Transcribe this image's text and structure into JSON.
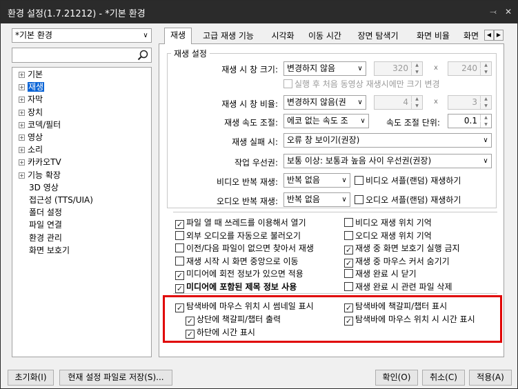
{
  "window": {
    "title": "환경 설정(1.7.21212) - *기본 환경"
  },
  "left": {
    "profile": "*기본 환경",
    "search_placeholder": "",
    "tree": [
      {
        "label": "기본",
        "expandable": true,
        "selected": false
      },
      {
        "label": "재생",
        "expandable": true,
        "selected": true
      },
      {
        "label": "자막",
        "expandable": true,
        "selected": false
      },
      {
        "label": "장치",
        "expandable": true,
        "selected": false
      },
      {
        "label": "코덱/필터",
        "expandable": true,
        "selected": false
      },
      {
        "label": "영상",
        "expandable": true,
        "selected": false
      },
      {
        "label": "소리",
        "expandable": true,
        "selected": false
      },
      {
        "label": "카카오TV",
        "expandable": true,
        "selected": false
      },
      {
        "label": "기능 확장",
        "expandable": true,
        "selected": false
      },
      {
        "label": "3D 영상",
        "expandable": false,
        "selected": false
      },
      {
        "label": "접근성 (TTS/UIA)",
        "expandable": false,
        "selected": false
      },
      {
        "label": "폴더 설정",
        "expandable": false,
        "selected": false
      },
      {
        "label": "파일 연결",
        "expandable": false,
        "selected": false
      },
      {
        "label": "환경 관리",
        "expandable": false,
        "selected": false
      },
      {
        "label": "화면 보호기",
        "expandable": false,
        "selected": false
      }
    ]
  },
  "tabs": [
    "재생",
    "고급 재생 기능",
    "시각화",
    "이동 시간",
    "장면 탐색기",
    "화면 비율",
    "화면"
  ],
  "group_title": "재생 설정",
  "settings": {
    "window_size_label": "재생 시 창 크기:",
    "window_size_value": "변경하지 않음",
    "width": "320",
    "height": "240",
    "times": "x",
    "first_only_label": "실행 후 처음 동영상 재생시에만 크기 변경",
    "ratio_label": "재생 시 창 비율:",
    "ratio_value": "변경하지 않음(권",
    "ratio_w": "4",
    "ratio_h": "3",
    "speed_label": "재생 속도 조절:",
    "speed_value": "에코 없는 속도 조",
    "speed_unit_label": "속도 조절 단위:",
    "speed_unit_value": "0.1",
    "fail_label": "재생 실패 시:",
    "fail_value": "오류 창 보이기(권장)",
    "priority_label": "작업 우선권:",
    "priority_value": "보통 이상: 보통과 높음 사이 우선권(권장)",
    "video_repeat_label": "비디오 반복 재생:",
    "video_repeat_value": "반복 없음",
    "video_shuffle_label": "비디오 셔플(랜덤) 재생하기",
    "audio_repeat_label": "오디오 반복 재생:",
    "audio_repeat_value": "반복 없음",
    "audio_shuffle_label": "오디오 셔플(랜덤) 재생하기"
  },
  "options_left": [
    {
      "label": "파일 열 때 쓰레드를 이용해서 열기",
      "checked": true
    },
    {
      "label": "외부 오디오를 자동으로 불러오기",
      "checked": false
    },
    {
      "label": "이전/다음 파일이 없으면 찾아서 재생",
      "checked": false
    },
    {
      "label": "재생 시작 시 화면 중앙으로 이동",
      "checked": false
    },
    {
      "label": "미디어에 회전 정보가 있으면 적용",
      "checked": true
    },
    {
      "label": "미디어에 포함된 제목 정보 사용",
      "checked": true
    }
  ],
  "options_right": [
    {
      "label": "비디오 재생 위치 기억",
      "checked": false
    },
    {
      "label": "오디오 재생 위치 기억",
      "checked": false
    },
    {
      "label": "재생 중 화면 보호기 실행 금지",
      "checked": true
    },
    {
      "label": "재생 중 마우스 커서 숨기기",
      "checked": true
    },
    {
      "label": "재생 완료 시 닫기",
      "checked": false
    },
    {
      "label": "재생 완료 시 관련 파일 삭제",
      "checked": false
    }
  ],
  "seekbar": {
    "thumb": "탐색바에 마우스 위치 시 썸네일 표시",
    "thumb_top": "상단에 책갈피/챕터 출력",
    "thumb_bottom": "하단에 시간 표시",
    "bookmark": "탐색바에 책갈피/챕터 표시",
    "time": "탐색바에 마우스 위치 시 시간 표시"
  },
  "buttons": {
    "reset": "초기화(I)",
    "save_as": "현재 설정 파일로 저장(S)...",
    "ok": "확인(O)",
    "cancel": "취소(C)",
    "apply": "적용(A)"
  },
  "colors": {
    "highlight": "#e00000",
    "selection": "#0a64d6",
    "titlebar": "#2b2b2b"
  }
}
